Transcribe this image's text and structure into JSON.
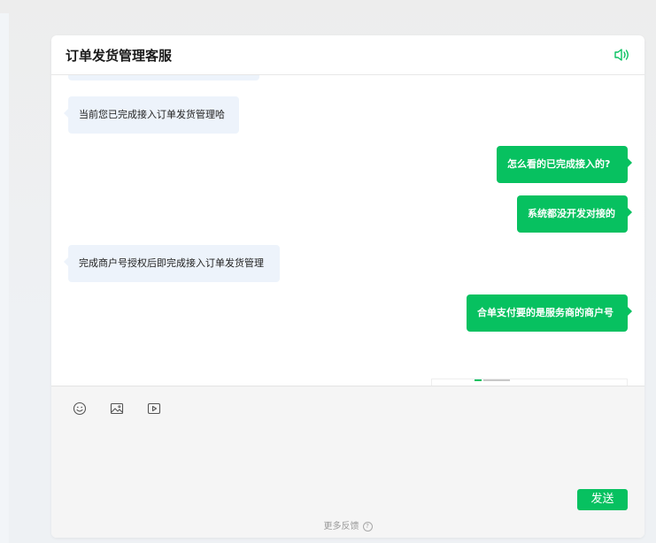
{
  "header": {
    "title": "订单发货管理客服",
    "speaker_icon": "speaker-icon"
  },
  "messages": [
    {
      "side": "left",
      "text": "当前您已完成接入订单发货管理哈"
    },
    {
      "side": "right",
      "text": "怎么看的已完成接入的?"
    },
    {
      "side": "right",
      "text": "系统都没开发对接的"
    },
    {
      "side": "left",
      "text": "完成商户号授权后即完成接入订单发货管理"
    },
    {
      "side": "right",
      "text": "合单支付要的是服务商的商户号"
    },
    {
      "side": "right",
      "type": "image",
      "text": ""
    }
  ],
  "toolbar": {
    "icons": [
      "emoji-icon",
      "image-icon",
      "video-icon"
    ],
    "send_label": "发送"
  },
  "footer": {
    "feedback_label": "更多反馈",
    "help_symbol": "?"
  },
  "colors": {
    "accent": "#07c160",
    "left_bubble": "#edf3fb",
    "toolbar_bg": "#f5f5f5"
  }
}
